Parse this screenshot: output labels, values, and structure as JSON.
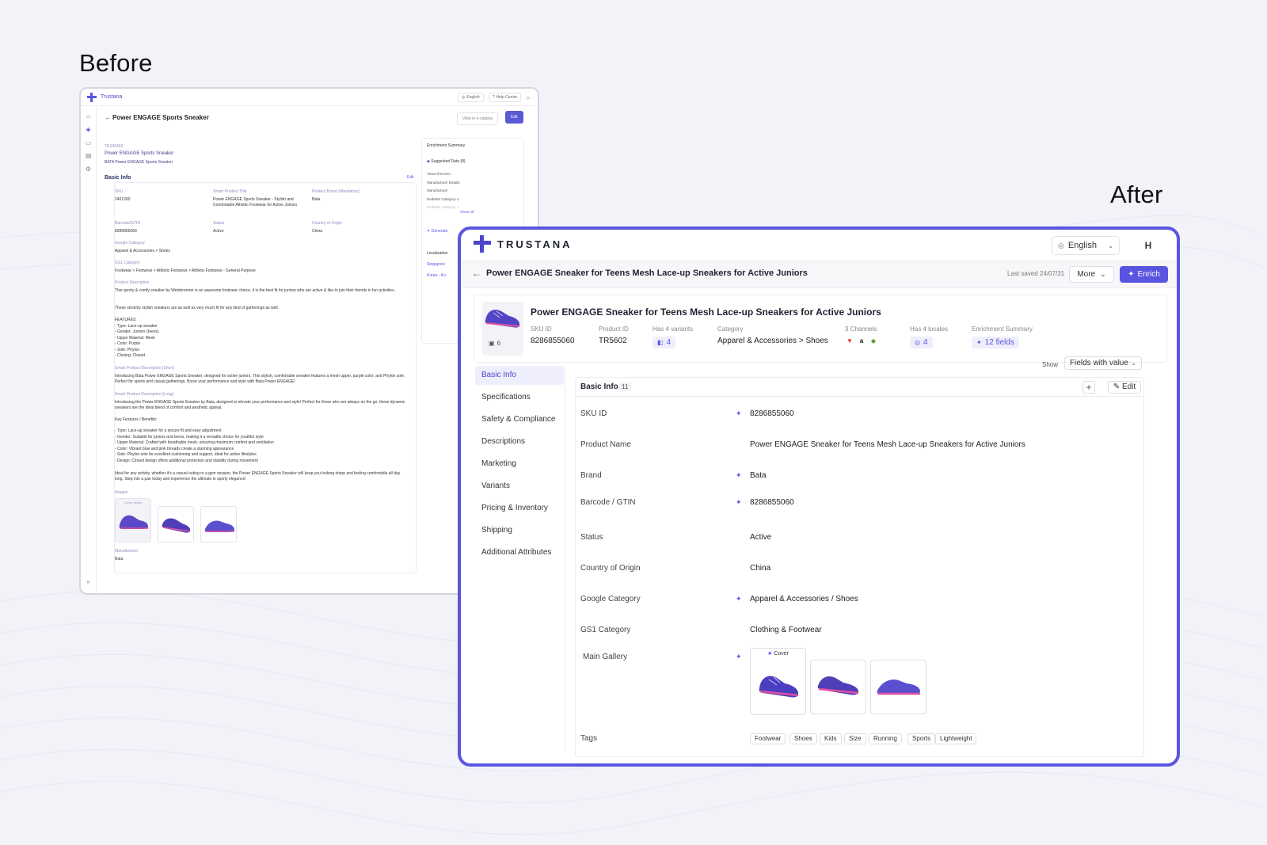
{
  "headings": {
    "before": "Before",
    "after": "After"
  },
  "before": {
    "brand": "Trustana",
    "top": {
      "lang": "English",
      "help": "Help Center"
    },
    "title": "Power ENGAGE Sports Sneaker",
    "view_btn": "View in e-catalog",
    "edit_btn": "Edit",
    "id_line": "TR100492",
    "name1": "Power ENGAGE Sports Sneaker",
    "name2": "BATA Power ENGAGE Sports Sneaker",
    "section": "Basic Info",
    "section_edit": "Edit",
    "f_sku_lbl": "SKU",
    "f_sku_val": "2401200",
    "f_smart_lbl": "Smart Product Title",
    "f_smart_val": "Power ENGAGE Sports Sneaker - Stylish and Comfortable Athletic Footwear for Active Juniors",
    "f_brand_lbl": "Product Brand (Mandatory)",
    "f_brand_val": "Bata",
    "f_barcode_lbl": "Barcode/GTIN",
    "f_barcode_val": "8286855060",
    "f_status_lbl": "Status",
    "f_status_val": "Active",
    "f_country_lbl": "Country of Origin",
    "f_country_val": "China",
    "f_gcat_lbl": "Google Category",
    "f_gcat_val": "Apparel & Accessories > Shoes",
    "f_gs1_lbl": "GS1 Category",
    "f_gs1_val": "Footwear > Footwear > Athletic Footwear > Athletic Footwear - General Purpose",
    "f_desc_lbl": "Product Description",
    "f_desc_p1": "This sporty & comfy sneaker by Weinbrenner is an awesome footwear choice, it is the best fit for juniors who are active & like to join their friends in fun activities.",
    "f_desc_p2": "These stretchy stylish sneakers are as well as very much fit for any kind of gatherings as well.",
    "f_desc_features": [
      "FEATURES:",
      "- Type: Lace-up sneaker",
      "- Gender: Juniors (teens)",
      "- Upper Material: Mesh",
      "- Color: Purple",
      "- Sole: Phylon",
      "- Closing: Closed"
    ],
    "f_short_lbl": "Smart Product Description (Short)",
    "f_short_val": "Introducing Bata Power ENGAGE Sports Sneaker, designed for active juniors. This stylish, comfortable sneaker features a mesh upper, purple color, and Phylon sole. Perfect for sports and casual gatherings. Boost your performance and style with Bata Power ENGAGE!",
    "f_long_lbl": "Smart Product Description (Long)",
    "f_long_p1": "Introducing the Power ENGAGE Sports Sneaker by Bata, designed to elevate your performance and style! Perfect for those who are always on the go, these dynamic sneakers are the ideal blend of comfort and aesthetic appeal.",
    "f_long_kf": "Key Features / Benefits:",
    "f_long_list": [
      "- Type: Lace-up sneaker for a secure fit and easy adjustment",
      "- Gender: Suitable for juniors and teens, making it a versatile choice for youthful style",
      "- Upper Material: Crafted with breathable mesh, ensuring maximum comfort and ventilation",
      "- Color: Vibrant blue and pink threads create a stunning appearance",
      "- Sole: Phylon sole for excellent cushioning and support, ideal for active lifestyles",
      "- Design: Closed design offers additional protection and stability during movement"
    ],
    "f_long_p3": "Ideal for any activity, whether it's a casual outing or a gym session, the Power ENGAGE Sports Sneaker will keep you looking sharp and feeling comfortable all day long. Step into a pair today and experience the ultimate in sporty elegance!",
    "f_images_lbl": "Images",
    "f_cover": "Cover photo",
    "f_manu_lbl": "Manufacturer",
    "f_manu_val": "Bata",
    "enr_title": "Enrichment Summary",
    "enr_sugg": "Suggested Data (8)",
    "enr_items": [
      "About this item",
      "Manufacturer Details",
      "Manufacturer",
      "RedMart Category 2",
      "RedMart Category 1"
    ],
    "enr_show": "Show All",
    "enr_gen": "Generate",
    "loc_title": "Localization",
    "loc_items": [
      "Singapore",
      "Korea - Ko"
    ]
  },
  "after": {
    "brand": "TRUSTANA",
    "lang": "English",
    "avatar": "H",
    "bar_title": "Power ENGAGE Sneaker for Teens Mesh Lace-up Sneakers for Active Juniors",
    "last_saved": "Last saved 24/07/31",
    "more": "More",
    "enrich": "Enrich",
    "product_title": "Power ENGAGE Sneaker for Teens Mesh Lace-up Sneakers for Active Juniors",
    "image_count": "6",
    "meta": {
      "sku_lbl": "SKU ID",
      "sku_val": "8286855060",
      "pid_lbl": "Product ID",
      "pid_val": "TR5602",
      "variants_lbl": "Has 4 variants",
      "variants_val": "4",
      "cat_lbl": "Category",
      "cat_val": "Apparel & Accessories > Shoes",
      "channels_lbl": "3 Channels",
      "locales_lbl": "Has 4 locales",
      "locales_val": "4",
      "enr_lbl": "Enrichment Summary",
      "enr_val": "12 fields"
    },
    "nav": [
      "Basic Info",
      "Specifications",
      "Safety & Compliance",
      "Descriptions",
      "Marketing",
      "Variants",
      "Pricing & Inventory",
      "Shipping",
      "Additional Attributes"
    ],
    "show_lbl": "Show",
    "show_val": "Fields with value",
    "card_title": "Basic Info",
    "card_count": "11",
    "edit": "Edit",
    "rows": {
      "sku_lbl": "SKU ID",
      "sku_val": "8286855060",
      "name_lbl": "Product Name",
      "name_val": "Power ENGAGE Sneaker for Teens Mesh Lace-up Sneakers for Active Juniors",
      "brand_lbl": "Brand",
      "brand_val": "Bata",
      "barcode_lbl": "Barcode / GTIN",
      "barcode_val": "8286855060",
      "status_lbl": "Status",
      "status_val": "Active",
      "country_lbl": "Country of Origin",
      "country_val": "China",
      "gcat_lbl": "Google Category",
      "gcat_val": "Apparel & Accessories / Shoes",
      "gs1_lbl": "GS1 Category",
      "gs1_val": "Clothing & Footwear",
      "gallery_lbl": "Main Gallery",
      "cover": "Cover",
      "tags_lbl": "Tags"
    },
    "tags": [
      "Footwear",
      "Shoes",
      "Kids",
      "Size",
      "Running",
      "Sports",
      "Lightweight"
    ]
  },
  "colors": {
    "accent": "#5a55e0",
    "frame": "#5b55e0",
    "background": "#f2f2f9"
  }
}
